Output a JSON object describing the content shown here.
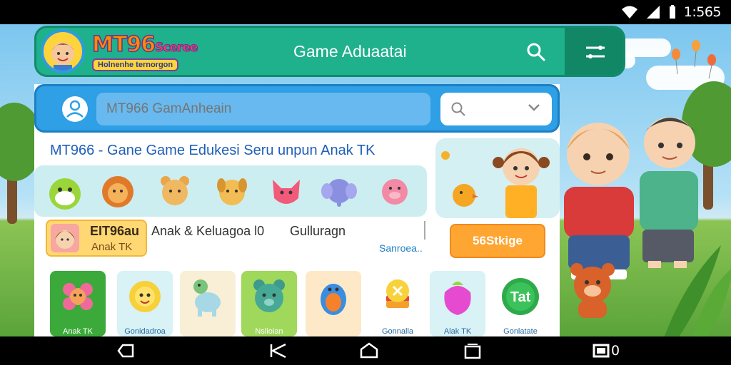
{
  "status_bar": {
    "time": "1:565"
  },
  "header": {
    "logo_title": "MT96",
    "logo_title_suffix": "Sceree",
    "logo_subtitle": "Holnenhe ternorgon",
    "title": "Game Aduaatai"
  },
  "search": {
    "placeholder": "MT966 GamAnheain"
  },
  "subtitle": "MT966 - Gane Game Edukesi Seru unpun Anak TK",
  "info": {
    "user_name": "EIT96au",
    "user_sub": "Anak TK",
    "label1": "Anak & Keluagoa l0",
    "label2": "Gulluragn",
    "link": "Sanroea..",
    "cta": "56Stkige"
  },
  "games": [
    {
      "label": "Anak TK",
      "bg": "#3caa3a",
      "icon": "flower-icon"
    },
    {
      "label": "Gonidadroa",
      "bg": "#d8f2f6",
      "icon": "sun-flower-icon"
    },
    {
      "label": "",
      "bg": "#f8efd6",
      "icon": "dino-icon"
    },
    {
      "label": "Nslioian",
      "bg": "#9fd85a",
      "icon": "bear-icon"
    },
    {
      "label": "",
      "bg": "#fde9c8",
      "icon": "bird-icon"
    },
    {
      "label": "Gonnalla",
      "bg": "#ffffff",
      "icon": "candy-icon"
    },
    {
      "label": "Alak TK",
      "bg": "#d8f2f6",
      "icon": "apple-icon"
    },
    {
      "label": "Gonlatate",
      "bg": "#ffffff",
      "icon": "tat-icon"
    }
  ],
  "game_badge": "Tat",
  "nav": {
    "count": "0"
  },
  "colors": {
    "header": "#1fb08c",
    "search_bar": "#2f9fe6",
    "cta": "#ffa531"
  }
}
